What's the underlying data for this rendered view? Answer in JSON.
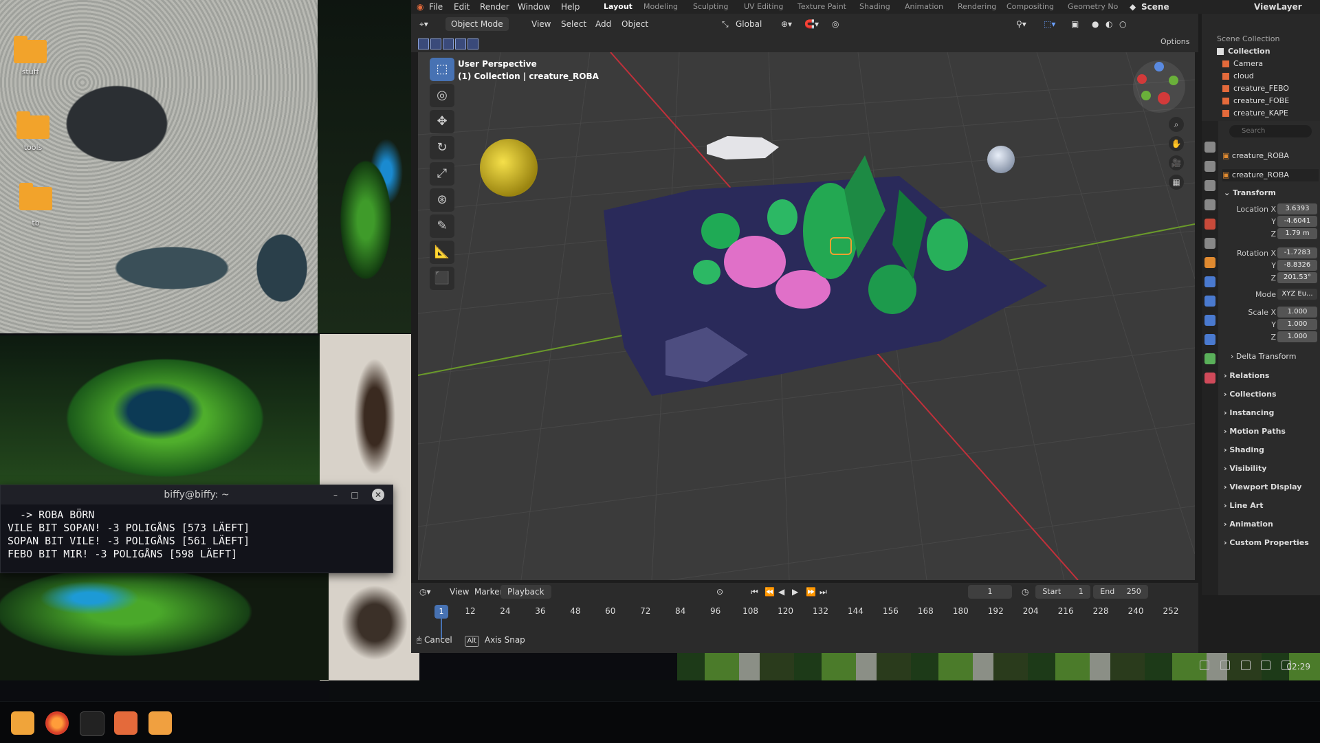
{
  "desktop": {
    "folders": [
      "stuff",
      "tools",
      "tb"
    ]
  },
  "terminal": {
    "title": "biffy@biffy: ~",
    "lines": [
      "  -> ROBA BÖRN",
      "VILE BIT SOPAN! -3 POLIGÅNS [573 LÄEFT]",
      "SOPAN BIT VILE! -3 POLIGÅNS [561 LÄEFT]",
      "FEBO BIT MIR! -3 POLIGÅNS [598 LÄEFT]"
    ]
  },
  "blender": {
    "menus": [
      "File",
      "Edit",
      "Render",
      "Window",
      "Help"
    ],
    "workspaces": [
      "Layout",
      "Modeling",
      "Sculpting",
      "UV Editing",
      "Texture Paint",
      "Shading",
      "Animation",
      "Rendering",
      "Compositing",
      "Geometry No"
    ],
    "scene": "Scene",
    "view_layer": "ViewLayer",
    "header": {
      "mode": "Object Mode",
      "view": "View",
      "select": "Select",
      "add": "Add",
      "object": "Object",
      "orientation": "Global",
      "options": "Options"
    },
    "viewport": {
      "perspective": "User Perspective",
      "collection": "(1) Collection | creature_ROBA"
    },
    "outliner": {
      "root": "Scene Collection",
      "collection": "Collection",
      "items": [
        "Camera",
        "cloud",
        "creature_FEBO",
        "creature_FOBE",
        "creature_KAPE"
      ]
    },
    "properties": {
      "search_placeholder": "Search",
      "object_name": "creature_ROBA",
      "data_name": "creature_ROBA",
      "section": "Transform",
      "location": {
        "label": "Location X",
        "x": "3.6393",
        "y": "-4.6041",
        "z": "1.79 m"
      },
      "rotation": {
        "label": "Rotation X",
        "x": "-1.7283",
        "y": "-8.8326",
        "z": "201.53°"
      },
      "mode_label": "Mode",
      "mode_value": "XYZ Eu...",
      "scale": {
        "label": "Scale X",
        "x": "1.000",
        "y": "1.000",
        "z": "1.000"
      },
      "axis_y": "Y",
      "axis_z": "Z",
      "panels": [
        "Delta Transform",
        "Relations",
        "Collections",
        "Instancing",
        "Motion Paths",
        "Shading",
        "Visibility",
        "Viewport Display",
        "Line Art",
        "Animation",
        "Custom Properties"
      ]
    },
    "timeline": {
      "view": "View",
      "marker": "Marker",
      "playback": "Playback",
      "current_frame": "1",
      "start_label": "Start",
      "start": "1",
      "end_label": "End",
      "end": "250",
      "ticks": [
        "12",
        "24",
        "36",
        "48",
        "60",
        "72",
        "84",
        "96",
        "108",
        "120",
        "132",
        "144",
        "156",
        "168",
        "180",
        "192",
        "204",
        "216",
        "228",
        "240",
        "252"
      ],
      "playhead": "1"
    },
    "status": {
      "cancel": "Cancel",
      "alt_key": "Alt",
      "axis_snap": "Axis Snap"
    }
  },
  "tray": {
    "clock": "02:29"
  }
}
